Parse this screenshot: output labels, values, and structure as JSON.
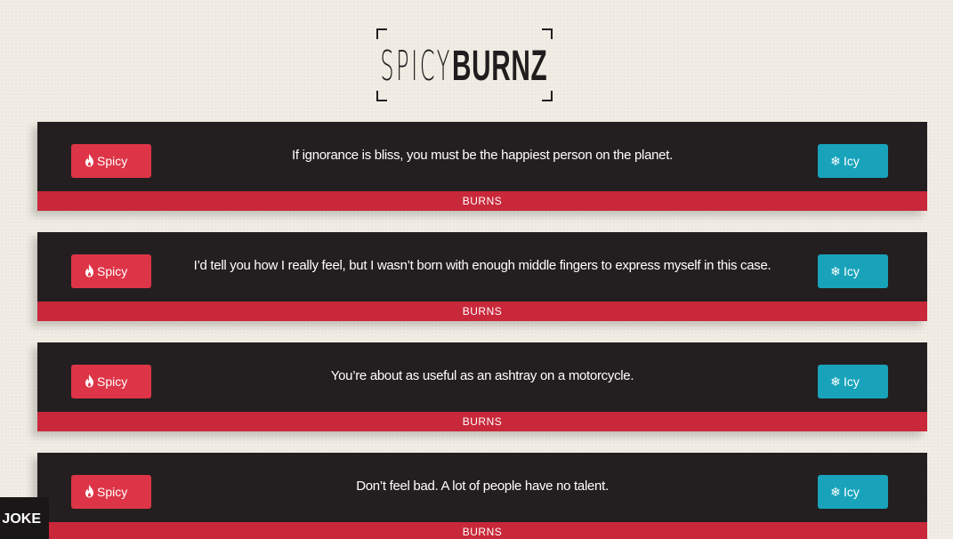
{
  "logo": {
    "part1": "SPICY",
    "part2": "BURNZ"
  },
  "buttons": {
    "spicy_label": "Spicy",
    "icy_label": "Icy",
    "spicy_icon": "flame-icon",
    "icy_icon": "snowflake-icon"
  },
  "cards": [
    {
      "text": "If ignorance is bliss, you must be the happiest person on the planet.",
      "category": "BURNS"
    },
    {
      "text": "I’d tell you how I really feel, but I wasn’t born with enough middle fingers to express myself in this case.",
      "category": "BURNS"
    },
    {
      "text": "You’re about as useful as an ashtray on a motorcycle.",
      "category": "BURNS"
    },
    {
      "text": "Don’t feel bad. A lot of people have no talent.",
      "category": "BURNS"
    }
  ],
  "side_tab": {
    "label": "A JOKE"
  },
  "colors": {
    "background": "#f1ede4",
    "card": "#231f20",
    "footer": "#c8283a",
    "spicy": "#dd3547",
    "icy": "#18a3bb"
  }
}
